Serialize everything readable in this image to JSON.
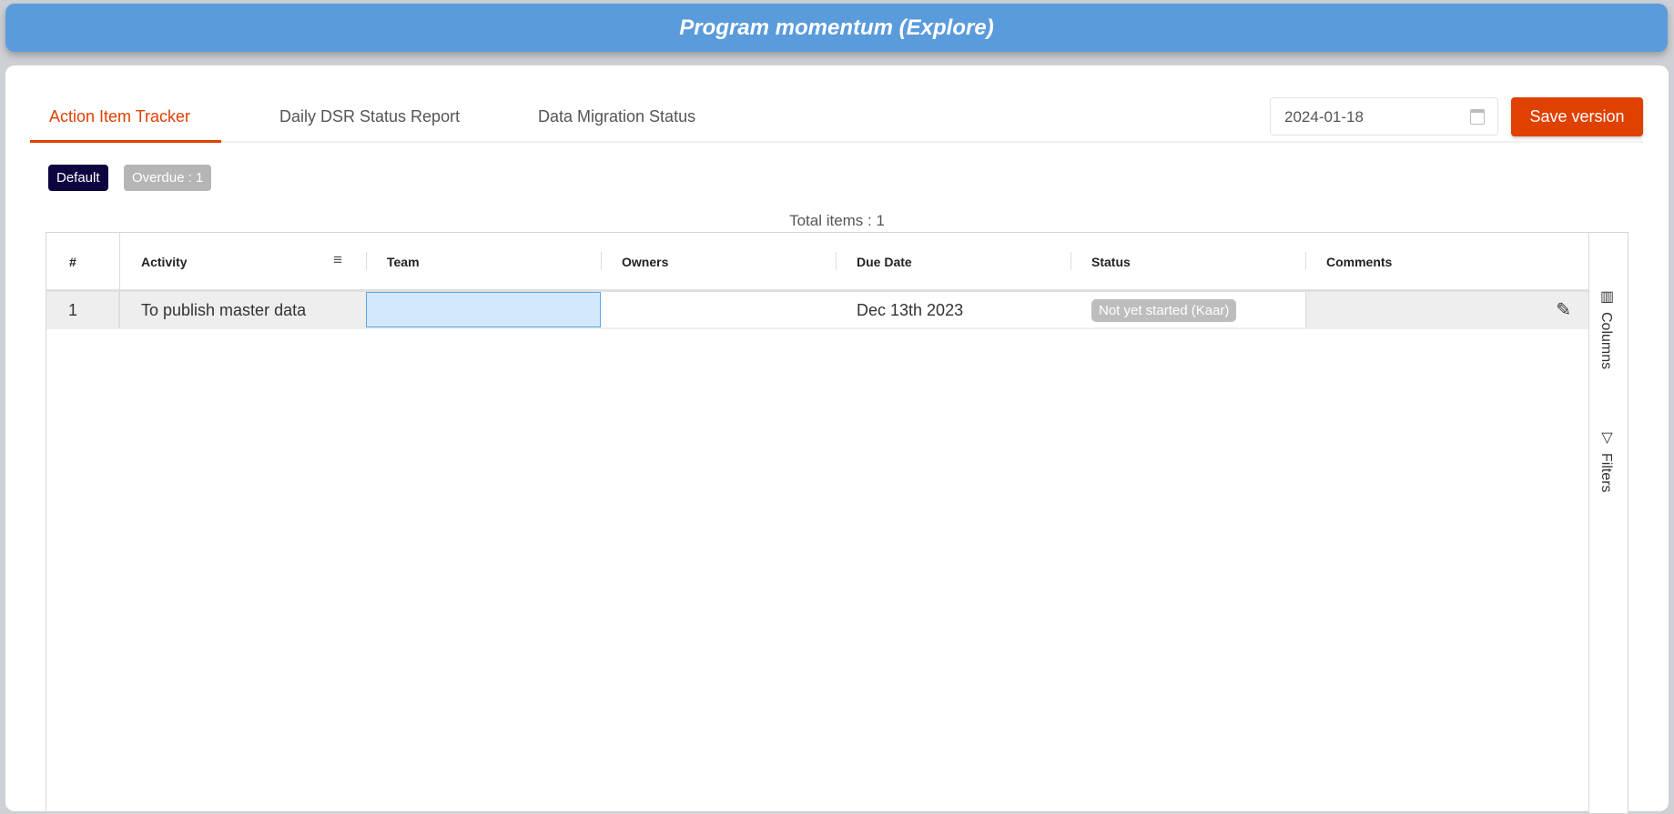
{
  "header": {
    "title": "Program momentum (Explore)"
  },
  "tabs": [
    {
      "label": "Action Item Tracker",
      "active": true
    },
    {
      "label": "Daily DSR Status Report"
    },
    {
      "label": "Data Migration Status"
    }
  ],
  "date_picker": {
    "value": "2024-01-18"
  },
  "save_button": {
    "label": "Save version"
  },
  "filters": {
    "default": "Default",
    "overdue": "Overdue : 1"
  },
  "total_items": "Total items : 1",
  "grid": {
    "columns": [
      "#",
      "Activity",
      "Team",
      "Owners",
      "Due Date",
      "Status",
      "Comments"
    ],
    "rows": [
      {
        "num": "1",
        "activity": "To publish master data",
        "team": "",
        "owners": "",
        "due": "Dec 13th 2023",
        "status": "Not yet started (Kaar)",
        "comments": ""
      }
    ]
  },
  "side_panel": {
    "columns": "Columns",
    "filters": "Filters"
  },
  "colors": {
    "accent": "#e04000",
    "header": "#5a9bdb",
    "default_badge": "#0b0640",
    "overdue_badge": "#b5b5b5"
  }
}
